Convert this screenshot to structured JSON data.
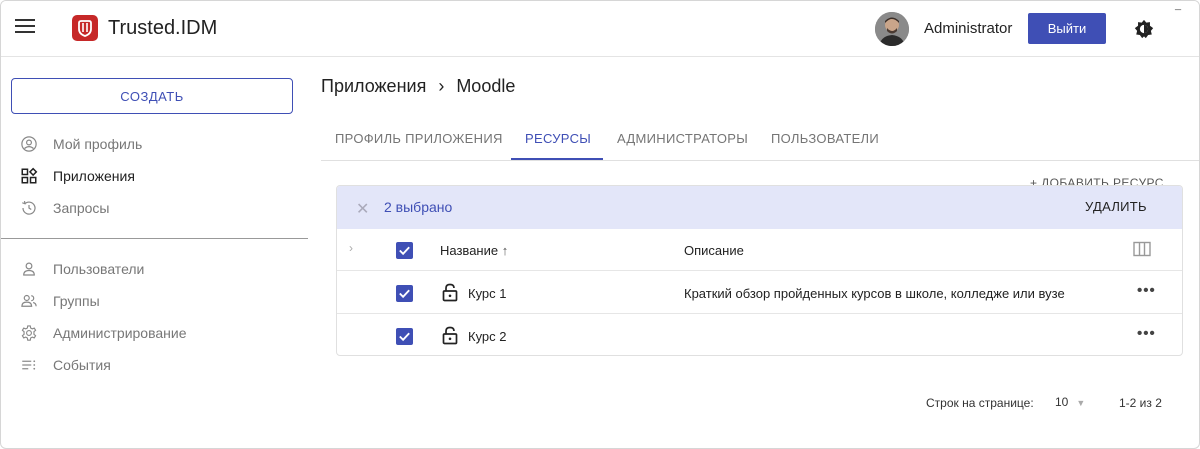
{
  "header": {
    "app_title": "Trusted.IDM",
    "user_name": "Administrator",
    "logout_label": "Выйти",
    "corner_mark": "¯"
  },
  "sidebar": {
    "create_label": "СОЗДАТЬ",
    "items": [
      {
        "label": "Мой профиль",
        "icon": "account-circle-icon"
      },
      {
        "label": "Приложения",
        "icon": "apps-grid-icon",
        "active": true
      },
      {
        "label": "Запросы",
        "icon": "history-icon"
      },
      {
        "label": "Пользователи",
        "icon": "person-icon"
      },
      {
        "label": "Группы",
        "icon": "group-icon"
      },
      {
        "label": "Администрирование",
        "icon": "gear-icon"
      },
      {
        "label": "События",
        "icon": "event-list-icon"
      }
    ]
  },
  "breadcrumb": {
    "parent": "Приложения",
    "separator": "›",
    "current": "Moodle"
  },
  "tabs": [
    {
      "label": "ПРОФИЛЬ ПРИЛОЖЕНИЯ"
    },
    {
      "label": "РЕСУРСЫ",
      "active": true
    },
    {
      "label": "АДМИНИСТРАТОРЫ"
    },
    {
      "label": "ПОЛЬЗОВАТЕЛИ"
    }
  ],
  "add_resource_label": "+ ДОБАВИТЬ РЕСУРС",
  "table": {
    "selection": {
      "close": "✕",
      "count_label": "2 выбрано",
      "delete_label": "УДАЛИТЬ"
    },
    "columns": {
      "name": "Название",
      "sort_indicator": "↑",
      "description": "Описание"
    },
    "rows": [
      {
        "name": "Курс 1",
        "description": "Краткий обзор пройденных курсов в школе, колледже или вузе",
        "checked": true
      },
      {
        "name": "Курс 2",
        "description": "",
        "checked": true
      }
    ],
    "row_actions": "•••"
  },
  "pagination": {
    "rows_label": "Строк на странице:",
    "rows_per_page": "10",
    "range": "1-2 из 2"
  },
  "colors": {
    "accent": "#3f4fb5",
    "selection_bg": "#e3e6f9",
    "logo": "#c62828"
  }
}
